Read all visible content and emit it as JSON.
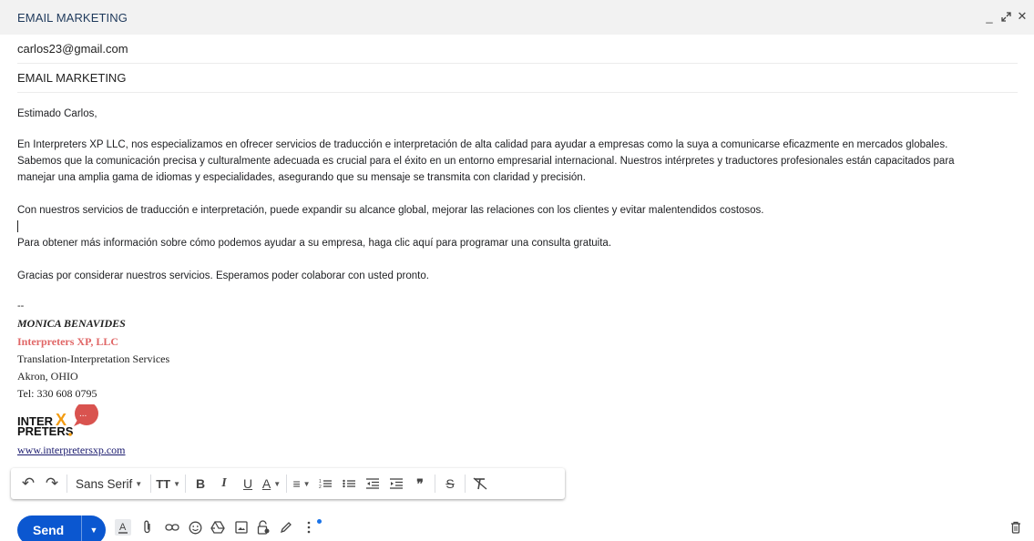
{
  "window": {
    "title": "EMAIL MARKETING",
    "minimize_glyph": "_",
    "popout_glyph": "⤢",
    "close_glyph": "✕"
  },
  "compose": {
    "recipient": "carlos23@gmail.com",
    "subject": "EMAIL MARKETING",
    "greeting": "Estimado Carlos,",
    "paragraph1_line1": "En Interpreters XP LLC, nos especializamos en ofrecer servicios de traducción e interpretación de alta calidad para ayudar a empresas como la suya a comunicarse eficazmente en mercados globales.",
    "paragraph1_line2": "Sabemos que la comunicación precisa y culturalmente adecuada es crucial para el éxito en un entorno empresarial internacional. Nuestros intérpretes y traductores profesionales están capacitados para",
    "paragraph1_line3": "manejar una amplia gama de idiomas y especialidades, asegurando que su mensaje se transmita con claridad y precisión.",
    "paragraph2": "Con nuestros servicios de traducción e interpretación, puede expandir su alcance global, mejorar las relaciones con los clientes y evitar malentendidos costosos.",
    "paragraph3": "Para obtener más información sobre cómo podemos ayudar a su empresa, haga clic aquí para programar una consulta gratuita.",
    "paragraph4": "Gracias por considerar nuestros servicios. Esperamos poder colaborar con usted pronto."
  },
  "signature": {
    "separator": "--",
    "name": "MONICA BENAVIDES",
    "company": "Interpreters XP, LLC",
    "services": "Translation-Interpretation Services",
    "location": "Akron, OHIO",
    "phone": "Tel: 330 608 0795",
    "logo_text_line1": "INTER",
    "logo_text_line2": "PRETERS",
    "logo_x": "X",
    "logo_bubble": "...",
    "website": "www.interpretersxp.com",
    "colors": {
      "company": "#e06666",
      "logo_orange": "#f39c12",
      "logo_red": "#d9534f"
    }
  },
  "toolbar": {
    "undo": "↶",
    "redo": "↷",
    "font": "Sans Serif",
    "size_icon": "TT",
    "bold": "B",
    "italic": "I",
    "underline": "U",
    "text_color": "A",
    "align": "≡",
    "numbered_list": "1≡",
    "bulleted_list": "•≡",
    "indent_less": "⇤",
    "indent_more": "⇥",
    "quote": "❞",
    "strikethrough": "S",
    "clear_formatting": "T̸"
  },
  "bottom": {
    "send_label": "Send",
    "accent": "#0b57d0",
    "icons": [
      "formatting-icon",
      "attach-icon",
      "link-icon",
      "emoji-icon",
      "drive-icon",
      "photo-icon",
      "lock-icon",
      "signature-icon",
      "more-options-icon",
      "trash-icon"
    ]
  }
}
